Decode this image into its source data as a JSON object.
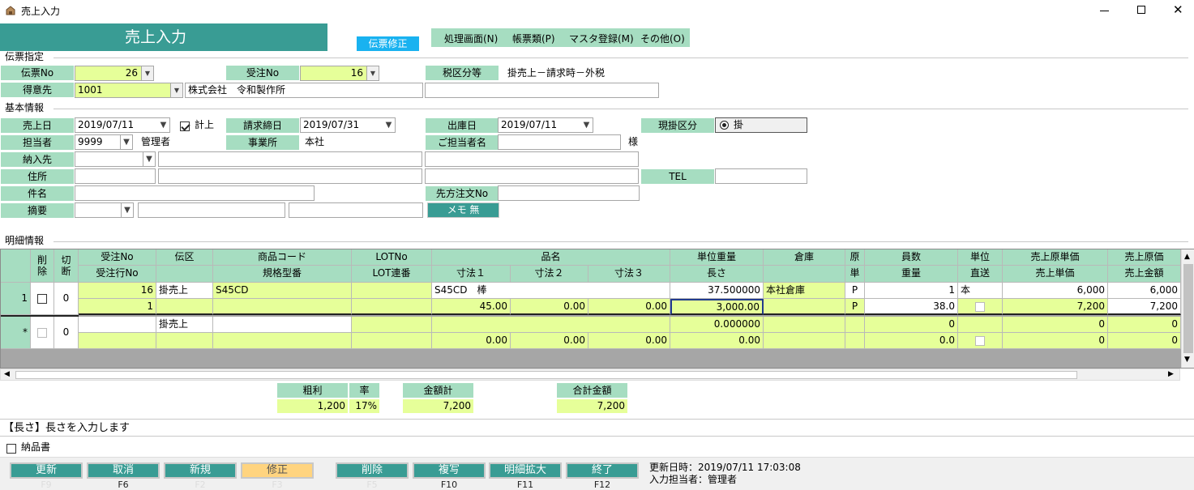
{
  "window": {
    "title": "売上入力"
  },
  "header": {
    "title": "売上入力",
    "mode_badge": "伝票修正",
    "menu": [
      "処理画面(N)",
      "帳票類(P)",
      "マスタ登録(M)",
      "その他(O)"
    ]
  },
  "denpyo": {
    "section": "伝票指定",
    "denpyo_no_label": "伝票No",
    "denpyo_no": "26",
    "juchu_no_label": "受注No",
    "juchu_no": "16",
    "tax_label": "税区分等",
    "tax_value": "掛売上－請求時－外税",
    "tokui_label": "得意先",
    "tokui_code": "1001",
    "tokui_name": "株式会社　令和製作所"
  },
  "kihon": {
    "section": "基本情報",
    "uriage_date_label": "売上日",
    "uriage_date": "2019/07/11",
    "keijo_label": "計上",
    "seikyu_label": "請求締日",
    "seikyu_date": "2019/07/31",
    "shukko_label": "出庫日",
    "shukko_date": "2019/07/11",
    "genkake_label": "現掛区分",
    "genkake_value": "掛",
    "tanto_label": "担当者",
    "tanto_code": "9999",
    "tanto_name": "管理者",
    "jigyosho_label": "事業所",
    "jigyosho_value": "本社",
    "gotanto_label": "ご担当者名",
    "sama": "様",
    "nounyu_label": "納入先",
    "jusho_label": "住所",
    "tel_label": "TEL",
    "kenmei_label": "件名",
    "sakigata_label": "先方注文No",
    "tekiyo_label": "摘要",
    "memo_button": "メモ 無"
  },
  "meisai": {
    "section": "明細情報",
    "headers1": [
      "削除",
      "切断",
      "受注No",
      "伝区",
      "商品コード",
      "LOTNo",
      "品名",
      "単位重量",
      "倉庫",
      "原",
      "員数",
      "単位",
      "売上原単価",
      "売上原価"
    ],
    "headers2": [
      "受注行No",
      "規格型番",
      "LOT連番",
      "寸法１",
      "寸法２",
      "寸法３",
      "長さ",
      "単",
      "重量",
      "直送",
      "売上単価",
      "売上金額"
    ],
    "rows": [
      {
        "no": "1",
        "cut": "0",
        "juchu_no": "16",
        "denku": "掛売上",
        "shohin": "S45CD",
        "hinmei": "S45CD　棒",
        "tani_juryo": "37.500000",
        "soko": "本社倉庫",
        "gen": "P",
        "insu": "1",
        "tani": "本",
        "genka_tanka": "6,000",
        "genka": "6,000",
        "juchu_gyo": "1",
        "sunpo1": "45.00",
        "sunpo2": "0.00",
        "sunpo3": "0.00",
        "nagasa": "3,000.00",
        "tan": "P",
        "juryo": "38.0",
        "tanka": "7,200",
        "kingaku": "7,200"
      },
      {
        "no": "*",
        "cut": "0",
        "juchu_no": "",
        "denku": "掛売上",
        "shohin": "",
        "hinmei": "",
        "tani_juryo": "0.000000",
        "soko": "",
        "gen": "",
        "insu": "0",
        "tani": "",
        "genka_tanka": "0",
        "genka": "0",
        "juchu_gyo": "",
        "sunpo1": "0.00",
        "sunpo2": "0.00",
        "sunpo3": "0.00",
        "nagasa": "0.00",
        "tan": "",
        "juryo": "0.0",
        "tanka": "0",
        "kingaku": "0"
      }
    ]
  },
  "summary": {
    "arari_label": "粗利",
    "arari": "1,200",
    "ritsu_label": "率",
    "ritsu": "17%",
    "kingaku_label": "金額計",
    "kingaku": "7,200",
    "gokei_label": "合計金額",
    "gokei": "7,200"
  },
  "hint": "【長さ】長さを入力します",
  "nohinsho_label": "納品書",
  "fbuttons": [
    {
      "label": "更新",
      "key": "F9"
    },
    {
      "label": "取消",
      "key": "F6"
    },
    {
      "label": "新規",
      "key": "F2"
    },
    {
      "label": "修正",
      "key": "F3"
    },
    {
      "label": "削除",
      "key": "F5"
    },
    {
      "label": "複写",
      "key": "F10"
    },
    {
      "label": "明細拡大",
      "key": "F11"
    },
    {
      "label": "終了",
      "key": "F12"
    }
  ],
  "footer": {
    "updated": "更新日時：2019/07/11 17:03:08",
    "operator": "入力担当者：管理者"
  },
  "colors": {
    "teal": "#399c94",
    "label_green": "#a6ddc1",
    "input_yellow": "#e6ff99",
    "active_orange": "#ffd47f"
  }
}
